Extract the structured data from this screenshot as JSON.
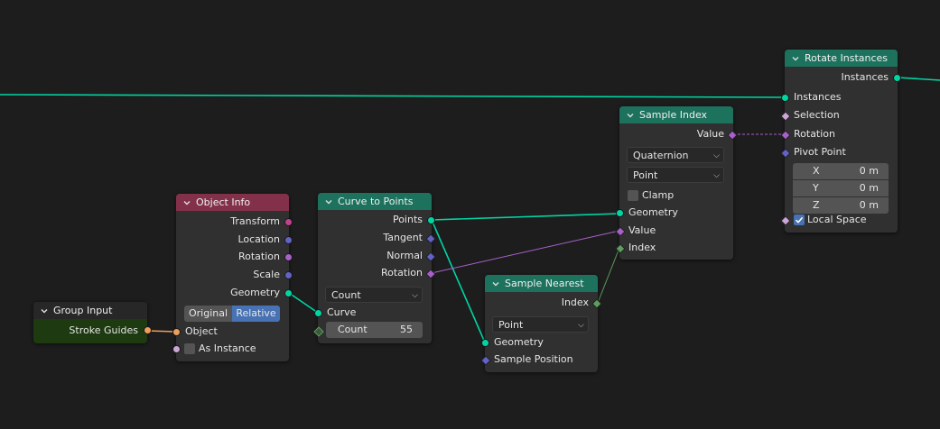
{
  "colors": {
    "geometry_link": "#00d6a3",
    "rotation_link": "#a861c9",
    "index_link": "#5e9d5e",
    "object_link": "#ed9e5c",
    "header_geometry": "#1d725e",
    "header_input": "#83314a",
    "header_group": "#272727",
    "group_body": "#1d3a10",
    "socket_geometry": "#00d6a3",
    "socket_rotation": "#a861c9",
    "socket_vector": "#6363c7",
    "socket_int": "#5e9d5e",
    "socket_object": "#ed9e5c",
    "socket_bool": "#cca6d6",
    "socket_matrix": "#c2418d",
    "accent": "#4772b3"
  },
  "nodes": {
    "group_input": {
      "title": "Group Input",
      "outputs": {
        "stroke_guides": "Stroke Guides"
      }
    },
    "object_info": {
      "title": "Object Info",
      "outputs": {
        "transform": "Transform",
        "location": "Location",
        "rotation": "Rotation",
        "scale": "Scale",
        "geometry": "Geometry"
      },
      "mode_options": [
        "Original",
        "Relative"
      ],
      "mode_selected": "Relative",
      "inputs": {
        "object": "Object",
        "as_instance": "As Instance"
      }
    },
    "curve_to_points": {
      "title": "Curve to Points",
      "outputs": {
        "points": "Points",
        "tangent": "Tangent",
        "normal": "Normal",
        "rotation": "Rotation"
      },
      "mode": "Count",
      "inputs": {
        "curve": "Curve",
        "count_label": "Count",
        "count_value": "55"
      }
    },
    "sample_nearest": {
      "title": "Sample Nearest",
      "outputs": {
        "index": "Index"
      },
      "domain": "Point",
      "inputs": {
        "geometry": "Geometry",
        "sample_position": "Sample Position"
      }
    },
    "sample_index": {
      "title": "Sample Index",
      "outputs": {
        "value": "Value"
      },
      "data_type": "Quaternion",
      "domain": "Point",
      "clamp_label": "Clamp",
      "inputs": {
        "geometry": "Geometry",
        "value": "Value",
        "index": "Index"
      }
    },
    "rotate_instances": {
      "title": "Rotate Instances",
      "outputs": {
        "instances": "Instances"
      },
      "inputs": {
        "instances": "Instances",
        "selection": "Selection",
        "rotation": "Rotation",
        "pivot_point": "Pivot Point",
        "local_space": "Local Space"
      },
      "pivot": {
        "x_label": "X",
        "x_value": "0 m",
        "y_label": "Y",
        "y_value": "0 m",
        "z_label": "Z",
        "z_value": "0 m"
      }
    }
  }
}
